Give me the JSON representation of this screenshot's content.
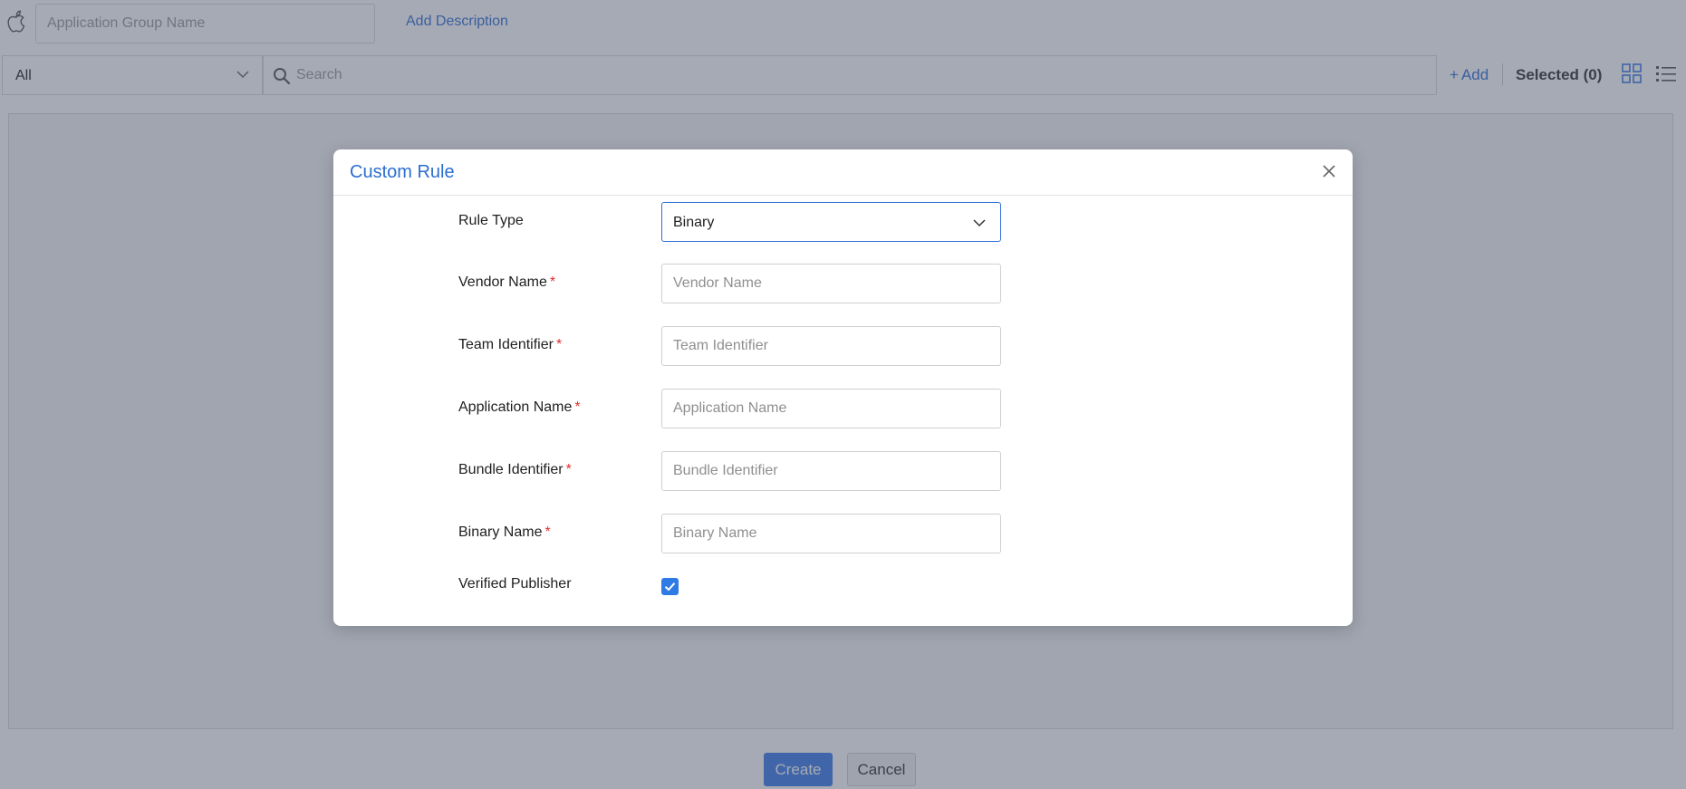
{
  "top_bar": {
    "group_name_placeholder": "Application Group Name",
    "add_description_label": "Add Description"
  },
  "filter_bar": {
    "filter_value": "All",
    "search_placeholder": "Search",
    "add_label": "Add",
    "selected_label": "Selected (0)"
  },
  "footer": {
    "create_label": "Create",
    "cancel_label": "Cancel"
  },
  "modal": {
    "title": "Custom Rule",
    "rule_type": {
      "label": "Rule Type",
      "value": "Binary"
    },
    "fields": [
      {
        "label": "Vendor Name",
        "placeholder": "Vendor Name",
        "required": true
      },
      {
        "label": "Team Identifier",
        "placeholder": "Team Identifier",
        "required": true
      },
      {
        "label": "Application Name",
        "placeholder": "Application Name",
        "required": true
      },
      {
        "label": "Bundle Identifier",
        "placeholder": "Bundle Identifier",
        "required": true
      },
      {
        "label": "Binary Name",
        "placeholder": "Binary Name",
        "required": true
      }
    ],
    "required_marker": "*",
    "verified_publisher": {
      "label": "Verified Publisher",
      "checked": true
    }
  },
  "colors": {
    "accent": "#2f6fd6",
    "title": "#2b6fd0",
    "required": "#e0312f",
    "checkbox": "#2f7be6",
    "create_button": "#3d7be8"
  },
  "icons": [
    "apple-icon",
    "chevron-down-icon",
    "search-icon",
    "plus-icon",
    "grid-view-icon",
    "list-view-icon",
    "close-icon",
    "check-icon"
  ]
}
